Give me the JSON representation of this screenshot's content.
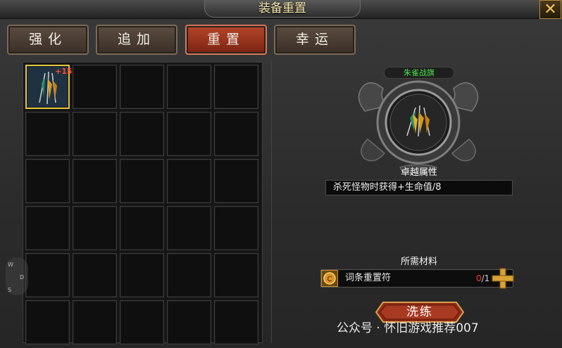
{
  "window": {
    "title": "装备重置",
    "close_label": "✕"
  },
  "tabs": [
    {
      "label": "强化",
      "active": false
    },
    {
      "label": "追加",
      "active": false
    },
    {
      "label": "重置",
      "active": true
    },
    {
      "label": "幸运",
      "active": false
    }
  ],
  "inventory": {
    "rows": 6,
    "cols": 5,
    "selected_item": {
      "row": 0,
      "col": 0,
      "plus": "+15",
      "icon": "banner-icon"
    }
  },
  "item": {
    "name": "朱雀战旗",
    "icon": "banner-icon"
  },
  "excellent": {
    "title": "卓越属性",
    "attribute": "杀死怪物时获得+生命值/8"
  },
  "materials": {
    "title": "所需材料",
    "items": [
      {
        "name": "词条重置符",
        "have": "0",
        "need": "/1",
        "icon": "coin-icon"
      }
    ]
  },
  "wash_button": {
    "label": "洗练"
  },
  "compass_hint": {
    "w": "W",
    "d": "D",
    "s": "S"
  },
  "watermark": "公众号 · 怀旧游戏推荐007",
  "colors": {
    "tab_active": "#a93a22",
    "item_name": "#4de04a",
    "count_zero": "#ff3b30",
    "title_text": "#f2e6a8"
  }
}
